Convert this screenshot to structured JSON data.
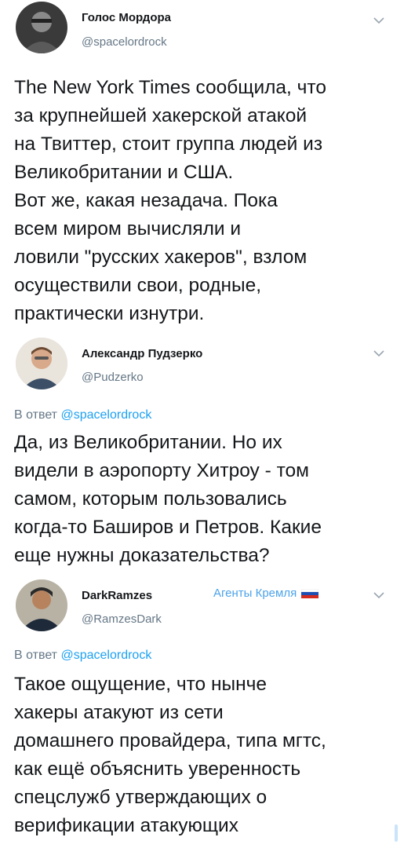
{
  "tweets": [
    {
      "name": "Голос Мордора",
      "handle": "@spacelordrock",
      "text": "The New York Times сообщила, что\nза крупнейшей хакерской атакой\nна Твиттер, стоит группа людей из\nВеликобритании и США.\nВот же, какая незадача. Пока\nвсем миром вычисляли и\nловили \"русских хакеров\", взлом\nосуществили свои, родные,\nпрактически изнутри."
    },
    {
      "name": "Александр Пудзерко",
      "handle": "@Pudzerko",
      "reply_prefix": "В ответ",
      "reply_mention": "@spacelordrock",
      "text": "Да, из Великобритании. Но их\nвидели в аэропорту Хитроу - том\nсамом, которым пользовались\nкогда-то Баширов и Петров. Какие\nеще нужны доказательства?"
    },
    {
      "name": "DarkRamzes",
      "handle": "@RamzesDark",
      "badge": "Агенты Кремля",
      "reply_prefix": "В ответ",
      "reply_mention": "@spacelordrock",
      "text": "Такое ощущение, что нынче\nхакеры атакуют из сети\nдомашнего провайдера, типа мгтс,\nкак ещё объяснить уверенность\nспецслужб утверждающих о\nверификации атакующих"
    }
  ],
  "icons": {
    "chevron": "chevron-down-icon",
    "flag": "russia-flag-icon"
  },
  "colors": {
    "text": "#14171a",
    "secondary": "#657786",
    "link": "#1da1f2",
    "badge": "#4da3ea"
  }
}
